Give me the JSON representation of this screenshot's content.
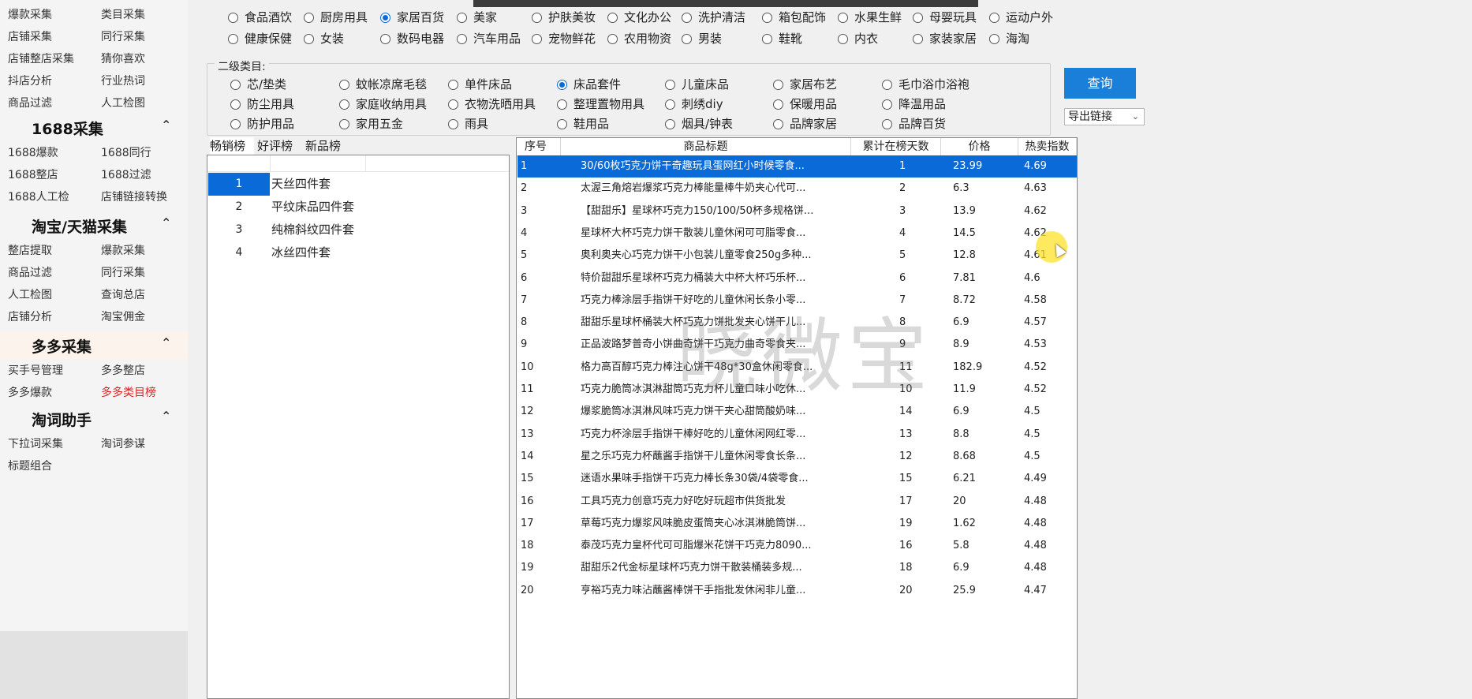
{
  "sidebar": {
    "top_links": [
      [
        "爆款采集",
        "类目采集"
      ],
      [
        "店铺采集",
        "同行采集"
      ],
      [
        "店铺整店采集",
        "猜你喜欢"
      ],
      [
        "抖店分析",
        "行业热词"
      ],
      [
        "商品过滤",
        "人工检图"
      ]
    ],
    "sections": [
      {
        "title": "1688采集",
        "links": [
          [
            "1688爆款",
            "1688同行"
          ],
          [
            "1688整店",
            "1688过滤"
          ],
          [
            "1688人工检",
            "店铺链接转换"
          ]
        ]
      },
      {
        "title": "淘宝/天猫采集",
        "links": [
          [
            "整店提取",
            "爆款采集"
          ],
          [
            "商品过滤",
            "同行采集"
          ],
          [
            "人工检图",
            "查询总店"
          ],
          [
            "店铺分析",
            "淘宝佣金"
          ]
        ]
      },
      {
        "title": "多多采集",
        "links": [
          [
            "买手号管理",
            "多多整店"
          ],
          [
            "多多爆款",
            "多多类目榜"
          ]
        ]
      },
      {
        "title": "淘词助手",
        "links": [
          [
            "下拉词采集",
            "淘词参谋"
          ],
          [
            "标题组合",
            ""
          ]
        ]
      }
    ],
    "active_link": "多多类目榜"
  },
  "category1": {
    "selected": "家居百货",
    "rows": [
      [
        "食品酒饮",
        "厨房用具",
        "家居百货",
        "美家",
        "护肤美妆",
        "文化办公",
        "洗护清洁",
        "箱包配饰",
        "水果生鲜",
        "母婴玩具",
        "运动户外"
      ],
      [
        "健康保健",
        "女装",
        "数码电器",
        "汽车用品",
        "宠物鲜花",
        "农用物资",
        "男装",
        "鞋靴",
        "内衣",
        "家装家居",
        "海淘"
      ]
    ]
  },
  "category2": {
    "title": "二级类目:",
    "selected": "床品套件",
    "rows": [
      [
        "芯/垫类",
        "蚊帐凉席毛毯",
        "单件床品",
        "床品套件",
        "儿童床品",
        "家居布艺",
        "毛巾浴巾浴袍"
      ],
      [
        "防尘用具",
        "家庭收纳用具",
        "衣物洗晒用具",
        "整理置物用具",
        "刺绣diy",
        "保暖用品",
        "降温用品"
      ],
      [
        "防护用品",
        "家用五金",
        "雨具",
        "鞋用品",
        "烟具/钟表",
        "品牌家居",
        "品牌百货"
      ]
    ]
  },
  "query_label": "查询",
  "export_label": "导出链接",
  "tabs": [
    "畅销榜",
    "好评榜",
    "新品榜"
  ],
  "active_tab": "畅销榜",
  "subcategories": [
    {
      "n": "1",
      "name": "天丝四件套"
    },
    {
      "n": "2",
      "name": "平纹床品四件套"
    },
    {
      "n": "3",
      "name": "纯棉斜纹四件套"
    },
    {
      "n": "4",
      "name": "冰丝四件套"
    }
  ],
  "table": {
    "headers": [
      "序号",
      "商品标题",
      "累计在榜天数",
      "价格",
      "热卖指数"
    ],
    "rows": [
      [
        "1",
        "30/60枚巧克力饼干奇趣玩具蛋网红小时候零食...",
        "1",
        "23.99",
        "4.69"
      ],
      [
        "2",
        "太渥三角熔岩爆浆巧克力棒能量棒牛奶夹心代可...",
        "2",
        "6.3",
        "4.63"
      ],
      [
        "3",
        "【甜甜乐】星球杯巧克力150/100/50杯多规格饼...",
        "3",
        "13.9",
        "4.62"
      ],
      [
        "4",
        "星球杯大杯巧克力饼干散装儿童休闲可可脂零食...",
        "4",
        "14.5",
        "4.62"
      ],
      [
        "5",
        "奥利奥夹心巧克力饼干小包装儿童零食250g多种...",
        "5",
        "12.8",
        "4.61"
      ],
      [
        "6",
        "特价甜甜乐星球杯巧克力桶装大中杯大杯巧乐杯...",
        "6",
        "7.81",
        "4.6"
      ],
      [
        "7",
        "巧克力棒涂层手指饼干好吃的儿童休闲长条小零...",
        "7",
        "8.72",
        "4.58"
      ],
      [
        "8",
        "甜甜乐星球杯桶装大杯巧克力饼批发夹心饼干儿...",
        "8",
        "6.9",
        "4.57"
      ],
      [
        "9",
        "正品波路梦普奇小饼曲奇饼干巧克力曲奇零食夹...",
        "9",
        "8.9",
        "4.53"
      ],
      [
        "10",
        "格力高百醇巧克力棒注心饼干48g*30盒休闲零食...",
        "11",
        "182.9",
        "4.52"
      ],
      [
        "11",
        "巧克力脆筒冰淇淋甜筒巧克力杯儿童口味小吃休...",
        "10",
        "11.9",
        "4.52"
      ],
      [
        "12",
        "爆浆脆筒冰淇淋风味巧克力饼干夹心甜筒酸奶味...",
        "14",
        "6.9",
        "4.5"
      ],
      [
        "13",
        "巧克力杯涂层手指饼干棒好吃的儿童休闲网红零...",
        "13",
        "8.8",
        "4.5"
      ],
      [
        "14",
        "星之乐巧克力杯蘸酱手指饼干儿童休闲零食长条...",
        "12",
        "8.68",
        "4.5"
      ],
      [
        "15",
        "迷语水果味手指饼干巧克力棒长条30袋/4袋零食...",
        "15",
        "6.21",
        "4.49"
      ],
      [
        "16",
        "工具巧克力创意巧克力好吃好玩超市供货批发",
        "17",
        "20",
        "4.48"
      ],
      [
        "17",
        "草莓巧克力爆浆风味脆皮蛋筒夹心冰淇淋脆筒饼...",
        "19",
        "1.62",
        "4.48"
      ],
      [
        "18",
        "泰茂巧克力皇杯代可可脂爆米花饼干巧克力8090...",
        "16",
        "5.8",
        "4.48"
      ],
      [
        "19",
        "甜甜乐2代金标星球杯巧克力饼干散装桶装多规...",
        "18",
        "6.9",
        "4.48"
      ],
      [
        "20",
        "亨裕巧克力味沾蘸酱棒饼干手指批发休闲非儿童...",
        "20",
        "25.9",
        "4.47"
      ]
    ]
  },
  "watermark": "晓微宝"
}
